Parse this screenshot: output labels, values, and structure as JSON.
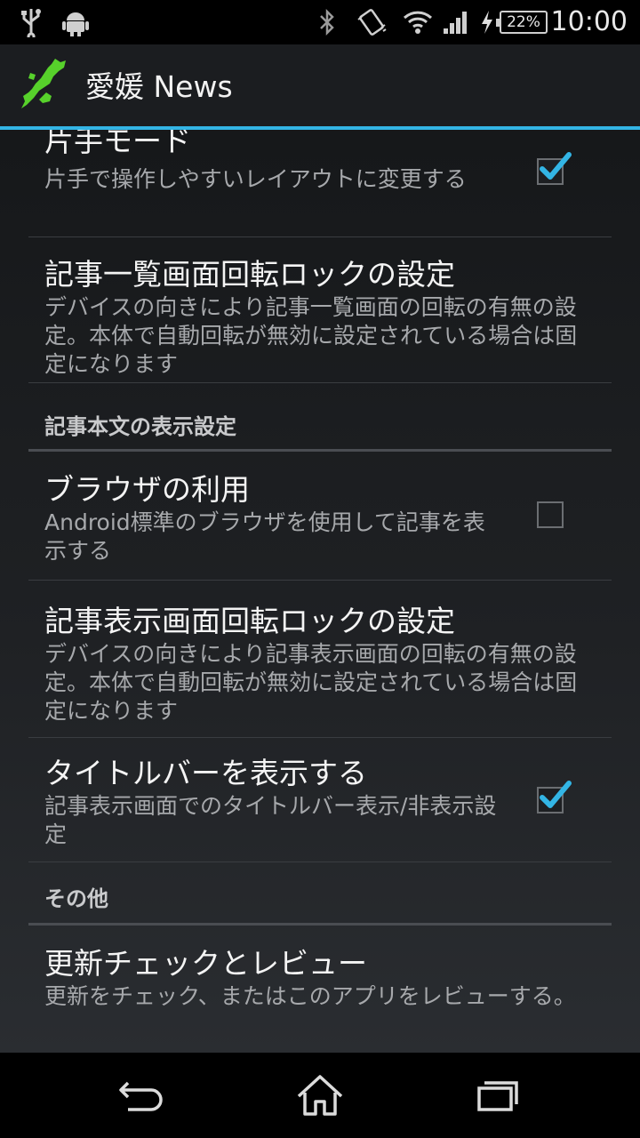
{
  "status_bar": {
    "time": "10:00",
    "battery_percent": "22%",
    "icons": [
      "usb-icon",
      "android-debug-icon",
      "bluetooth-icon",
      "vibrate-icon",
      "wifi-icon",
      "signal-icon",
      "charging-icon",
      "battery-icon"
    ]
  },
  "action_bar": {
    "title": "愛媛 News",
    "logo_icon": "ehime-map-logo"
  },
  "prefs": {
    "one_hand": {
      "title": "片手モード",
      "summary": "片手で操作しやすいレイアウトに変更する",
      "checked": true
    },
    "list_rotation_lock": {
      "title": "記事一覧画面回転ロックの設定",
      "summary": "デバイスの向きにより記事一覧画面の回転の有無の設定。本体で自動回転が無効に設定されている場合は固定になります"
    },
    "category_article_display": "記事本文の表示設定",
    "use_browser": {
      "title": "ブラウザの利用",
      "summary": "Android標準のブラウザを使用して記事を表示する",
      "checked": false
    },
    "article_rotation_lock": {
      "title": "記事表示画面回転ロックの設定",
      "summary": "デバイスの向きにより記事表示画面の回転の有無の設定。本体で自動回転が無効に設定されている場合は固定になります"
    },
    "show_title_bar": {
      "title": "タイトルバーを表示する",
      "summary": "記事表示画面でのタイトルバー表示/非表示設定",
      "checked": true
    },
    "category_other": "その他",
    "update_review": {
      "title": "更新チェックとレビュー",
      "summary": "更新をチェック、またはこのアプリをレビューする。"
    }
  },
  "nav_bar": {
    "buttons": [
      "back-icon",
      "home-icon",
      "recents-icon"
    ]
  },
  "colors": {
    "accent": "#33b5e5",
    "background": "#1f2124",
    "summary_text": "#a7a9ac"
  }
}
